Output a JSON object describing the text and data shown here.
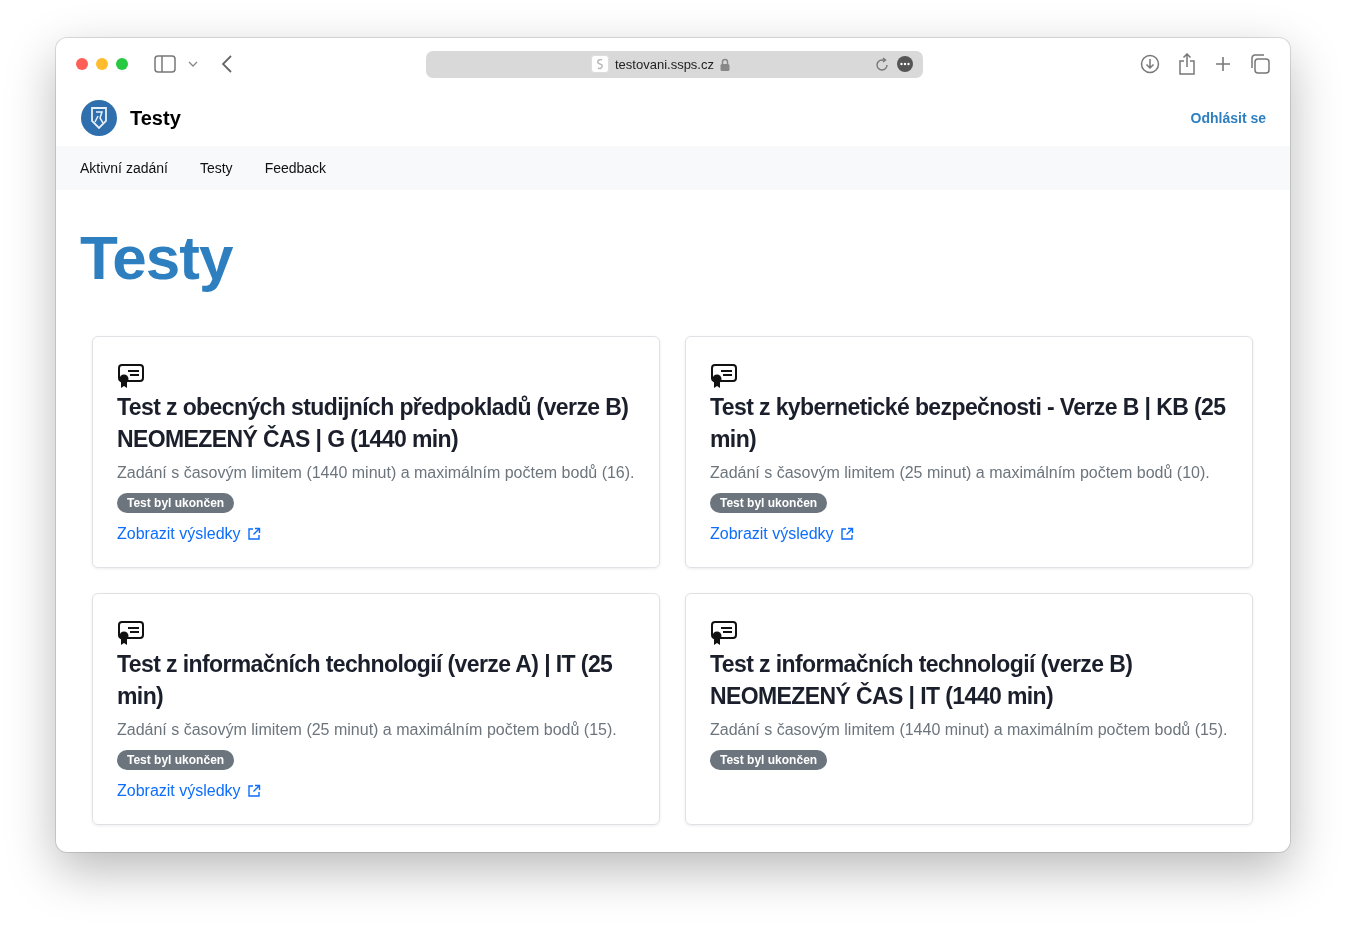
{
  "browser": {
    "url": "testovani.ssps.cz"
  },
  "header": {
    "brand": "Testy",
    "logout": "Odhlásit se"
  },
  "nav": [
    {
      "label": "Aktivní zadání"
    },
    {
      "label": "Testy"
    },
    {
      "label": "Feedback"
    }
  ],
  "page_title": "Testy",
  "tests": [
    {
      "title": "Test z obecných studijních předpokladů (verze B) NEOMEZENÝ ČAS | G (1440 min)",
      "description": "Zadání s časovým limitem (1440 minut) a maximálním počtem bodů (16).",
      "badge": "Test byl ukončen",
      "link": "Zobrazit výsledky"
    },
    {
      "title": "Test z kybernetické bezpečnosti - Verze B | KB (25 min)",
      "description": "Zadání s časovým limitem (25 minut) a maximálním počtem bodů (10).",
      "badge": "Test byl ukončen",
      "link": "Zobrazit výsledky"
    },
    {
      "title": "Test z informačních technologií (verze A) | IT (25 min)",
      "description": "Zadání s časovým limitem (25 minut) a maximálním počtem bodů (15).",
      "badge": "Test byl ukončen",
      "link": "Zobrazit výsledky"
    },
    {
      "title": "Test z informačních technologií (verze B) NEOMEZENÝ ČAS | IT (1440 min)",
      "description": "Zadání s časovým limitem (1440 minut) a maximálním počtem bodů (15).",
      "badge": "Test byl ukončen"
    }
  ]
}
